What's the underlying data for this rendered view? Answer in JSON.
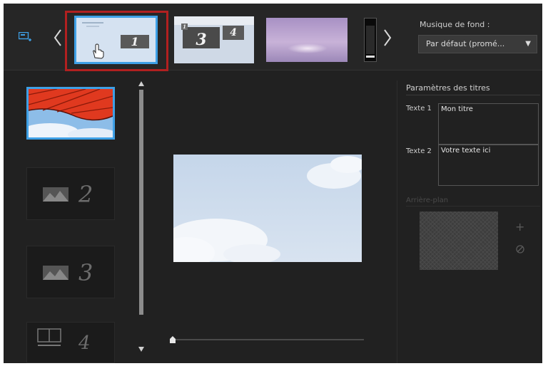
{
  "storyboard": {
    "thumbnails": [
      {
        "number": "1"
      },
      {
        "number_a": "3",
        "number_b": "4",
        "number_c": "1"
      },
      {},
      {}
    ]
  },
  "music": {
    "label": "Musique de fond :",
    "selected": "Par défaut (promé...",
    "dropdown_arrow": "▼"
  },
  "slides": {
    "items": [
      {
        "number": ""
      },
      {
        "number": "2"
      },
      {
        "number": "3"
      },
      {
        "number": "4"
      }
    ]
  },
  "params": {
    "title": "Paramètres des titres",
    "text1_label": "Texte 1",
    "text1_value": "Mon titre",
    "text2_label": "Texte 2",
    "text2_value": "Votre texte ici",
    "background_label": "Arrière-plan",
    "add_symbol": "+"
  },
  "icons": {
    "add_slide": "add-slide-icon",
    "prev": "chevron-left-icon",
    "next": "chevron-right-icon",
    "cursor": "hand-cursor-icon",
    "image_placeholder": "image-placeholder-icon",
    "layout": "layout-icon",
    "clear": "clear-icon"
  },
  "colors": {
    "accent": "#3ea0e6",
    "selection": "#b12020",
    "background": "#212121"
  }
}
